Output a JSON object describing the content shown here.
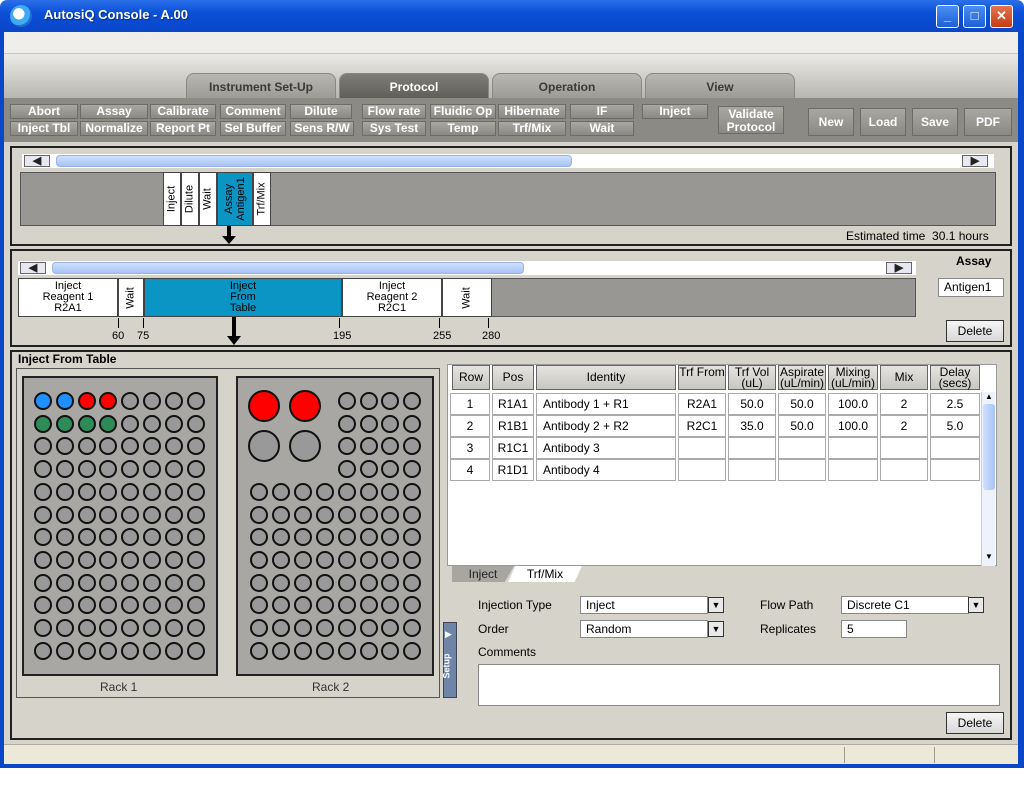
{
  "window": {
    "title": "AutosiQ Console - A.00",
    "min": "_",
    "max": "□",
    "close": "✕"
  },
  "tabs": [
    {
      "label": "Instrument Set-Up",
      "active": false
    },
    {
      "label": "Protocol",
      "active": true
    },
    {
      "label": "Operation",
      "active": false
    },
    {
      "label": "View",
      "active": false
    }
  ],
  "toolbar": {
    "row1": [
      "Abort",
      "Assay",
      "Calibrate",
      "Comment",
      "Dilute",
      "Flow rate",
      "Fluidic Op",
      "Hibernate",
      "IF",
      "Inject"
    ],
    "row2": [
      "Inject Tbl",
      "Normalize",
      "Report Pt",
      "Sel Buffer",
      "Sens R/W",
      "Sys Test",
      "Temp",
      "Trf/Mix",
      "Wait"
    ],
    "validate": "Validate Protocol",
    "right": [
      "New",
      "Load",
      "Save",
      "PDF"
    ]
  },
  "protocol_timeline": {
    "steps": [
      "Inject",
      "Dilute",
      "Wait",
      "Assay Antigen1",
      "Trf/Mix"
    ],
    "selected": "Assay Antigen1",
    "estimated_label": "Estimated time",
    "estimated_value": "30.1 hours"
  },
  "assay_timeline": {
    "heading": "Assay",
    "name": "Antigen1",
    "delete_label": "Delete",
    "steps": [
      {
        "line1": "Inject",
        "line2": "Reagent 1",
        "line3": "R2A1"
      },
      {
        "line1": "Wait",
        "line2": "",
        "line3": ""
      },
      {
        "line1": "Inject",
        "line2": "From",
        "line3": "Table"
      },
      {
        "line1": "Inject",
        "line2": "Reagent 2",
        "line3": "R2C1"
      },
      {
        "line1": "Wait",
        "line2": "",
        "line3": ""
      }
    ],
    "ticks": [
      "60",
      "75",
      "195",
      "255",
      "280"
    ]
  },
  "inject_table": {
    "title": "Inject From Table",
    "rack1_label": "Rack 1",
    "rack2_label": "Rack 2",
    "columns": [
      "Row",
      "Pos",
      "Identity",
      "Trf From",
      "Trf Vol (uL)",
      "Aspirate (uL/min)",
      "Mixing (uL/min)",
      "Mix",
      "Delay (secs)"
    ],
    "rows": [
      [
        "1",
        "R1A1",
        "Antibody 1 + R1",
        "R2A1",
        "50.0",
        "50.0",
        "100.0",
        "2",
        "2.5"
      ],
      [
        "2",
        "R1B1",
        "Antibody 2 + R2",
        "R2C1",
        "35.0",
        "50.0",
        "100.0",
        "2",
        "5.0"
      ],
      [
        "3",
        "R1C1",
        "Antibody 3",
        "",
        "",
        "",
        "",
        "",
        ""
      ],
      [
        "4",
        "R1D1",
        "Antibody 4",
        "",
        "",
        "",
        "",
        "",
        ""
      ]
    ],
    "subtabs": [
      "Inject",
      "Trf/Mix"
    ],
    "setup_label": "Setup",
    "injection_type_label": "Injection Type",
    "injection_type_value": "Inject",
    "order_label": "Order",
    "order_value": "Random",
    "flow_path_label": "Flow Path",
    "flow_path_value": "Discrete C1",
    "replicates_label": "Replicates",
    "replicates_value": "5",
    "comments_label": "Comments",
    "comments_value": "",
    "delete_label": "Delete"
  },
  "colors": {
    "selected": "#0a95c4",
    "blue_well": "#1e90ff",
    "red_well": "#ff0000",
    "green_well": "#2e8b57",
    "gray_well": "#999999"
  }
}
